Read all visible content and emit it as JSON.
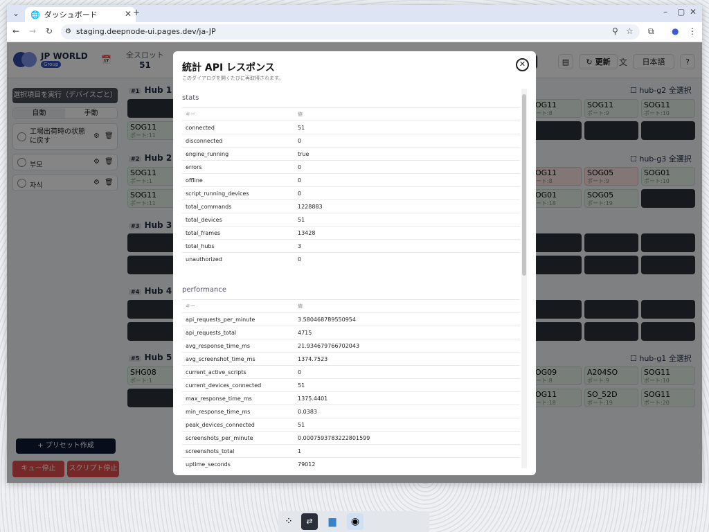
{
  "browser": {
    "tab_title": "ダッシュボード",
    "url": "staging.deepnode-ui.pages.dev/ja-JP"
  },
  "app": {
    "brand": "JP WORLD",
    "brand_badge": "Group",
    "slot_label": "全スロット",
    "slot_value": "51",
    "refresh_label": "更新",
    "language": "日本語"
  },
  "sidebar": {
    "run_selected": "選択項目を実行（デバイスごと）",
    "mode_auto": "自動",
    "mode_manual": "手動",
    "presets": [
      "工場出荷時の状態に戻す",
      "부모",
      "자식"
    ],
    "create_preset": "+ プリセット作成",
    "stop_queue": "キュー停止",
    "stop_script": "スクリプト停止"
  },
  "hubs": [
    {
      "num": "#1",
      "name": "Hub 1 h",
      "select_all": "hub-g2 全選択"
    },
    {
      "num": "#2",
      "name": "Hub 2 h",
      "select_all": "hub-g3 全選択"
    },
    {
      "num": "#3",
      "name": "Hub 3",
      "select_all": ""
    },
    {
      "num": "#4",
      "name": "Hub 4",
      "select_all": ""
    },
    {
      "num": "#5",
      "name": "Hub 5 h",
      "select_all": "hub-g1 全選択"
    }
  ],
  "tiles": {
    "h1a": {
      "name": "SOG11",
      "port": "ポート:11"
    },
    "h1b": {
      "name": "SOG11",
      "port": "ポート:8"
    },
    "h1c": {
      "name": "SOG11",
      "port": "ポート:9"
    },
    "h1d": {
      "name": "SOG11",
      "port": "ポート:10"
    },
    "h2a": {
      "name": "SOG11",
      "port": "ポート:1"
    },
    "h2b": {
      "name": "SOG11",
      "port": "ポート:11"
    },
    "h2c": {
      "name": "SOG11",
      "port": "ポート:8"
    },
    "h2d": {
      "name": "SOG05",
      "port": "ポート:9"
    },
    "h2e": {
      "name": "SOG01",
      "port": "ポート:10"
    },
    "h2f": {
      "name": "SOG01",
      "port": "ポート:18"
    },
    "h2g": {
      "name": "SOG05",
      "port": "ポート:19"
    },
    "h5a": {
      "name": "SHG08",
      "port": "ポート:1"
    },
    "h5b": {
      "name": "SOG09",
      "port": "ポート:8"
    },
    "h5c": {
      "name": "A204SO",
      "port": "ポート:9"
    },
    "h5d": {
      "name": "SOG11",
      "port": "ポート:10"
    },
    "h5e": {
      "name": "SOG11",
      "port": "ポート:18"
    },
    "h5f": {
      "name": "SO_52D",
      "port": "ポート:19"
    },
    "h5g": {
      "name": "SOG11",
      "port": "ポート:20"
    }
  },
  "modal": {
    "title": "統計 API レスポンス",
    "subtitle": "このダイアログを開くたびに再取得されます。",
    "key_header": "キー",
    "value_header": "値",
    "sections": [
      {
        "name": "stats",
        "rows": [
          [
            "connected",
            "51"
          ],
          [
            "disconnected",
            "0"
          ],
          [
            "engine_running",
            "true"
          ],
          [
            "errors",
            "0"
          ],
          [
            "offline",
            "0"
          ],
          [
            "script_running_devices",
            "0"
          ],
          [
            "total_commands",
            "1228883"
          ],
          [
            "total_devices",
            "51"
          ],
          [
            "total_frames",
            "13428"
          ],
          [
            "total_hubs",
            "3"
          ],
          [
            "unauthorized",
            "0"
          ]
        ]
      },
      {
        "name": "performance",
        "rows": [
          [
            "api_requests_per_minute",
            "3.580468789550954"
          ],
          [
            "api_requests_total",
            "4715"
          ],
          [
            "avg_response_time_ms",
            "21.934679766702043"
          ],
          [
            "avg_screenshot_time_ms",
            "1374.7523"
          ],
          [
            "current_active_scripts",
            "0"
          ],
          [
            "current_devices_connected",
            "51"
          ],
          [
            "max_response_time_ms",
            "1375.4401"
          ],
          [
            "min_response_time_ms",
            "0.0383"
          ],
          [
            "peak_devices_connected",
            "51"
          ],
          [
            "screenshots_per_minute",
            "0.0007593783222801599"
          ],
          [
            "screenshots_total",
            "1"
          ],
          [
            "uptime_seconds",
            "79012"
          ]
        ]
      }
    ]
  }
}
